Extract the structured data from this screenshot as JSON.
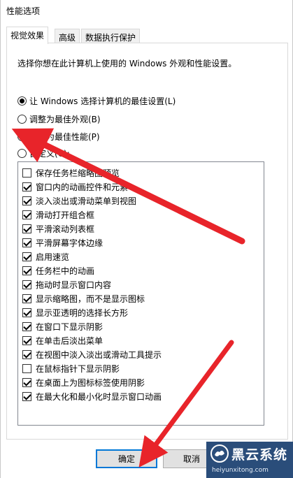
{
  "window": {
    "title": "性能选项"
  },
  "tabs": [
    {
      "label": "视觉效果"
    },
    {
      "label": "高级"
    },
    {
      "label": "数据执行保护"
    }
  ],
  "panel": {
    "description": "选择你想在此计算机上使用的 Windows 外观和性能设置。",
    "radios": [
      {
        "label": "让 Windows 选择计算机的最佳设置(L)",
        "checked": true
      },
      {
        "label": "调整为最佳外观(B)",
        "checked": false
      },
      {
        "label": "调整为最佳性能(P)",
        "checked": false
      },
      {
        "label": "自定义(C):",
        "checked": false
      }
    ],
    "effects": [
      {
        "label": "保存任务栏缩略图预览",
        "checked": false
      },
      {
        "label": "窗口内的动画控件和元素",
        "checked": true
      },
      {
        "label": "淡入淡出或滑动菜单到视图",
        "checked": true
      },
      {
        "label": "滑动打开组合框",
        "checked": true
      },
      {
        "label": "平滑滚动列表框",
        "checked": true
      },
      {
        "label": "平滑屏幕字体边缘",
        "checked": true
      },
      {
        "label": "启用速览",
        "checked": true
      },
      {
        "label": "任务栏中的动画",
        "checked": true
      },
      {
        "label": "拖动时显示窗口内容",
        "checked": true
      },
      {
        "label": "显示缩略图，而不是显示图标",
        "checked": true
      },
      {
        "label": "显示亚透明的选择长方形",
        "checked": true
      },
      {
        "label": "在窗口下显示阴影",
        "checked": true
      },
      {
        "label": "在单击后淡出菜单",
        "checked": true
      },
      {
        "label": "在视图中淡入淡出或滑动工具提示",
        "checked": true
      },
      {
        "label": "在鼠标指针下显示阴影",
        "checked": false
      },
      {
        "label": "在桌面上为图标标签使用阴影",
        "checked": true
      },
      {
        "label": "在最大化和最小化时显示窗口动画",
        "checked": true
      }
    ]
  },
  "buttons": {
    "ok": "确定",
    "cancel": "取消"
  },
  "watermark": {
    "brand": "黑云系统",
    "url": "heiyunxitong.com"
  },
  "colors": {
    "arrow": "#e8242a",
    "accent": "#0078d7",
    "watermark_bg": "#2a4d7a"
  }
}
